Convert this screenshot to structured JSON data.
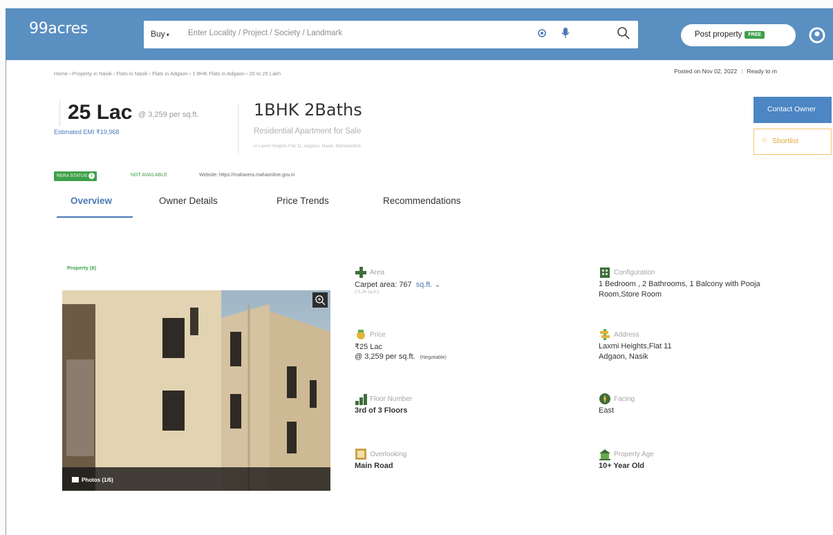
{
  "header": {
    "logo": "99acres",
    "buy_label": "Buy",
    "search_placeholder": "Enter Locality / Project / Society / Landmark",
    "post_property": "Post property",
    "free_badge": "FREE",
    "colors": {
      "bar": "#5a8fc1",
      "accent": "#4a79b6",
      "green": "#3ea14a"
    }
  },
  "breadcrumb": "Home › Property in Nasik › Flats in Nasik › Flats in Adgaon › 1 BHK Flats in Adgaon › 20 to 25 Lakh",
  "posted": {
    "date": "Posted on Nov 02, 2022",
    "status": "Ready to m"
  },
  "price": {
    "amount": "25 Lac",
    "per_sqft": "@ 3,259 per sq.ft.",
    "emi": "Estimated EMI ₹19,968"
  },
  "property": {
    "title": "1BHK 2Baths",
    "subtitle": "Residential Apartment for Sale",
    "address": "in Laxmi Heights Flat 11, Adgaon, Nasik, Maharashtra"
  },
  "actions": {
    "contact": "Contact Owner",
    "shortlist": "Shortlist"
  },
  "rera": {
    "badge": "RERA STATUS",
    "status": "NOT AVAILABLE",
    "website": "Website: https://maharera.mahaonline.gov.in"
  },
  "tabs": [
    "Overview",
    "Owner Details",
    "Price Trends",
    "Recommendations"
  ],
  "gallery": {
    "label": "Property (6)",
    "photos": "Photos (1/6)"
  },
  "features": {
    "area": {
      "label": "Area",
      "value": "Carpet area: 767",
      "unit": "sq.ft.",
      "sub": "(71.26 sq.m.)"
    },
    "config": {
      "label": "Configuration",
      "value": "1 Bedroom , 2 Bathrooms, 1 Balcony with Pooja",
      "value2": "Room,Store Room"
    },
    "price": {
      "label": "Price",
      "value": "₹25 Lac",
      "value2": "@ 3,259 per sq.ft.",
      "negotiable": "(Negotiable)"
    },
    "address": {
      "label": "Address",
      "value": "Laxmi Heights,Flat 11",
      "value2": "Adgaon, Nasik"
    },
    "floor": {
      "label": "Floor Number",
      "value": "3rd of 3 Floors"
    },
    "facing": {
      "label": "Facing",
      "value": "East"
    },
    "overlooking": {
      "label": "Overlooking",
      "value": "Main Road"
    },
    "age": {
      "label": "Property Age",
      "value": "10+ Year Old"
    }
  }
}
